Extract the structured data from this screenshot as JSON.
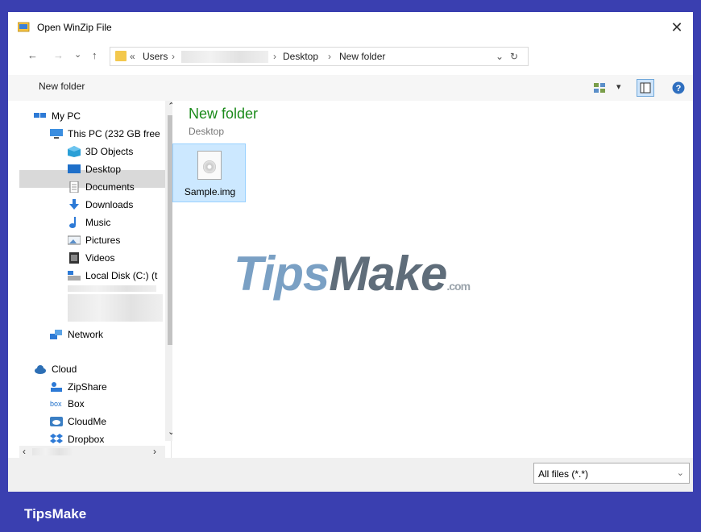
{
  "window": {
    "title": "Open WinZip File",
    "close": "✕"
  },
  "nav": {
    "back": "←",
    "forward": "→",
    "recent": "⌄",
    "up": "↑",
    "breadcrumbs": [
      "«",
      "Users",
      "›",
      "›",
      "Desktop",
      "›",
      "New folder"
    ],
    "addr_dropdown": "⌄",
    "refresh": "↻"
  },
  "toolbar": {
    "new_folder": "New folder",
    "view": "▾",
    "help": "?"
  },
  "sidebar": {
    "items": [
      {
        "label": "My PC",
        "icon": "computer-icon"
      },
      {
        "label": "This PC (232 GB free",
        "icon": "monitor-icon"
      },
      {
        "label": "3D Objects",
        "icon": "cube-icon"
      },
      {
        "label": "Desktop",
        "icon": "desktop-icon"
      },
      {
        "label": "Documents",
        "icon": "document-icon"
      },
      {
        "label": "Downloads",
        "icon": "download-icon"
      },
      {
        "label": "Music",
        "icon": "music-icon"
      },
      {
        "label": "Pictures",
        "icon": "picture-icon"
      },
      {
        "label": "Videos",
        "icon": "video-icon"
      },
      {
        "label": "Local Disk (C:) (t",
        "icon": "drive-icon"
      },
      {
        "label": "Network",
        "icon": "network-icon"
      },
      {
        "label": "Cloud",
        "icon": "cloud-icon"
      },
      {
        "label": "ZipShare",
        "icon": "zipshare-icon"
      },
      {
        "label": "Box",
        "icon": "box-icon"
      },
      {
        "label": "CloudMe",
        "icon": "cloudme-icon"
      },
      {
        "label": "Dropbox",
        "icon": "dropbox-icon"
      }
    ],
    "box_logo": "box",
    "scroll_up": "⌃",
    "scroll_down": "⌄",
    "scroll_left": "‹",
    "scroll_right": "›"
  },
  "content": {
    "folder_title": "New folder",
    "location": "Desktop",
    "files": [
      {
        "name": "Sample.img"
      }
    ]
  },
  "watermark": {
    "part1": "Tips",
    "part2": "Make",
    "suffix": ".com"
  },
  "filter": {
    "value": "All files (*.*)",
    "chevron": "⌄"
  },
  "footer": {
    "brand": "TipsMake"
  },
  "colors": {
    "accent_title": "#1a8a1a",
    "selection": "#cce8ff",
    "frame": "#3a3fb0"
  }
}
